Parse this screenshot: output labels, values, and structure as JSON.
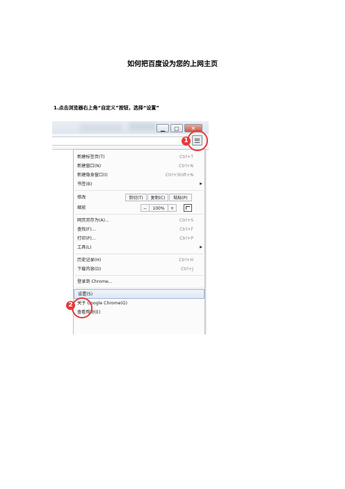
{
  "doc": {
    "title": "如何把百度设为您的上网主页",
    "step1": "1.点击浏览器右上角“自定义”按钮，选择“设置”"
  },
  "window": {
    "min": "▁",
    "max": "▢",
    "close": "✕"
  },
  "badges": {
    "one": "1",
    "two": "2"
  },
  "menu": {
    "new_tab": {
      "label": "新建标签页(T)",
      "shortcut": "Ctrl+T"
    },
    "new_window": {
      "label": "新建窗口(N)",
      "shortcut": "Ctrl+N"
    },
    "new_incognito": {
      "label": "新建隐身窗口(I)",
      "shortcut": "Ctrl+Shift+N"
    },
    "bookmarks": {
      "label": "书签(B)"
    },
    "edit": {
      "label": "修改",
      "cut": "剪切(T)",
      "copy": "复制(C)",
      "paste": "粘贴(P)"
    },
    "zoom": {
      "label": "缩放",
      "minus": "−",
      "value": "100%",
      "plus": "+"
    },
    "save_as": {
      "label": "网页另存为(A)...",
      "shortcut": "Ctrl+S"
    },
    "find": {
      "label": "查找(F)...",
      "shortcut": "Ctrl+F"
    },
    "print": {
      "label": "打印(P)...",
      "shortcut": "Ctrl+P"
    },
    "tools": {
      "label": "工具(L)"
    },
    "history": {
      "label": "历史记录(H)",
      "shortcut": "Ctrl+H"
    },
    "downloads": {
      "label": "下载内容(D)",
      "shortcut": "Ctrl+J"
    },
    "signin": {
      "label": "登录到 Chrome..."
    },
    "settings": {
      "label": "设置(S)"
    },
    "about": {
      "label": "关于 Google Chrome(G)"
    },
    "help": {
      "label": "查看帮助(E)"
    }
  }
}
